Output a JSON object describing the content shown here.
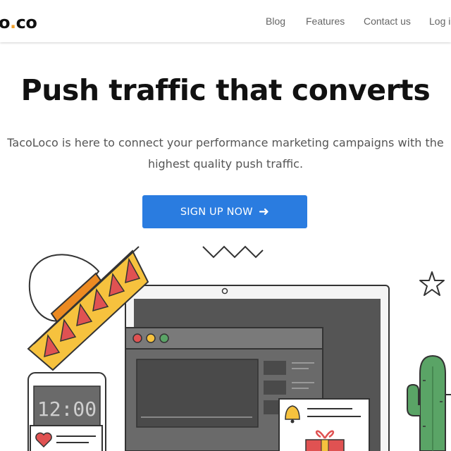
{
  "header": {
    "logo": {
      "text_main": "o",
      "text_dot": ".",
      "text_tail": "co"
    },
    "nav": [
      {
        "label": "Blog"
      },
      {
        "label": "Features"
      },
      {
        "label": "Contact us"
      },
      {
        "label": "Log in"
      }
    ]
  },
  "hero": {
    "title": "Push traffic that converts",
    "subtitle_line1": "TacoLoco is here to connect your performance marketing campaigns with the",
    "subtitle_line2": "highest quality push traffic.",
    "cta_label": "SIGN UP NOW",
    "cta_arrow": "➜"
  },
  "illustration": {
    "phone_time": "12:00",
    "colors": {
      "accent_blue": "#2a7ce0",
      "logo_orange": "#f0a02a",
      "sombrero_orange": "#ec8a22",
      "sombrero_red": "#e05252",
      "sombrero_yellow": "#f6c23e",
      "cactus_green": "#5aa466",
      "screen_dark": "#555555"
    },
    "icons": [
      "sombrero-icon",
      "star-icon",
      "zigzag-icon",
      "cactus-icon",
      "heart-icon",
      "bell-icon",
      "gift-icon"
    ]
  }
}
